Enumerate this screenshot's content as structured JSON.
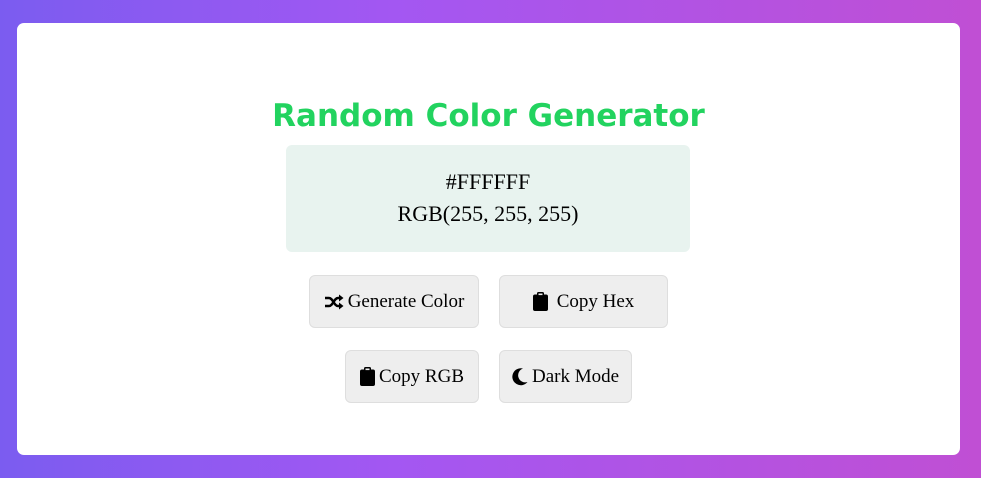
{
  "app": {
    "title": "Random Color Generator",
    "accent_color": "#22d35f",
    "background_gradient": [
      "#7b5cf0",
      "#a357f2",
      "#c04fd4"
    ]
  },
  "display": {
    "hex": "#FFFFFF",
    "rgb": "RGB(255, 255, 255)",
    "box_color": "#e8f3ef"
  },
  "buttons": {
    "generate": {
      "label": "Generate Color",
      "icon": "shuffle-icon"
    },
    "copy_hex": {
      "label": "Copy Hex",
      "icon": "clipboard-icon"
    },
    "copy_rgb": {
      "label": "Copy RGB",
      "icon": "clipboard-icon"
    },
    "dark_mode": {
      "label": "Dark Mode",
      "icon": "moon-icon"
    }
  }
}
